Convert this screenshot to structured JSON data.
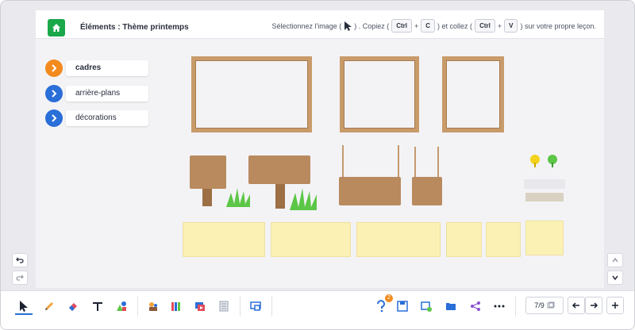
{
  "header": {
    "title": "Éléments : Thème printemps",
    "instruction_part1": "Sélectionnez l'image (",
    "instruction_part2": ") . Copiez (",
    "instruction_part3": ") et collez (",
    "instruction_part4": ") sur votre propre leçon.",
    "key_ctrl": "Ctrl",
    "key_c": "C",
    "key_v": "V",
    "plus": "+"
  },
  "categories": [
    {
      "label": "cadres",
      "color": "#f28a1e",
      "active": true
    },
    {
      "label": "arrière-plans",
      "color": "#2a6ed8",
      "active": false
    },
    {
      "label": "décorations",
      "color": "#2a6ed8",
      "active": false
    }
  ],
  "toolbar": {
    "pager": "7/9",
    "help_badge": "2",
    "icons": [
      "select-icon",
      "pencil-icon",
      "eraser-icon",
      "text-icon",
      "shapes-icon",
      "characters-icon",
      "library-icon",
      "media-icon",
      "notes-icon",
      "screen-icon",
      "help-icon",
      "save-icon",
      "add-slide-icon",
      "folder-icon",
      "share-icon",
      "more-icon"
    ]
  },
  "colors": {
    "accent_blue": "#2a6ed8",
    "accent_orange": "#f28a1e",
    "home_green": "#1aa84a",
    "wood": "#c89b6a",
    "paper": "#fbf1b5"
  }
}
